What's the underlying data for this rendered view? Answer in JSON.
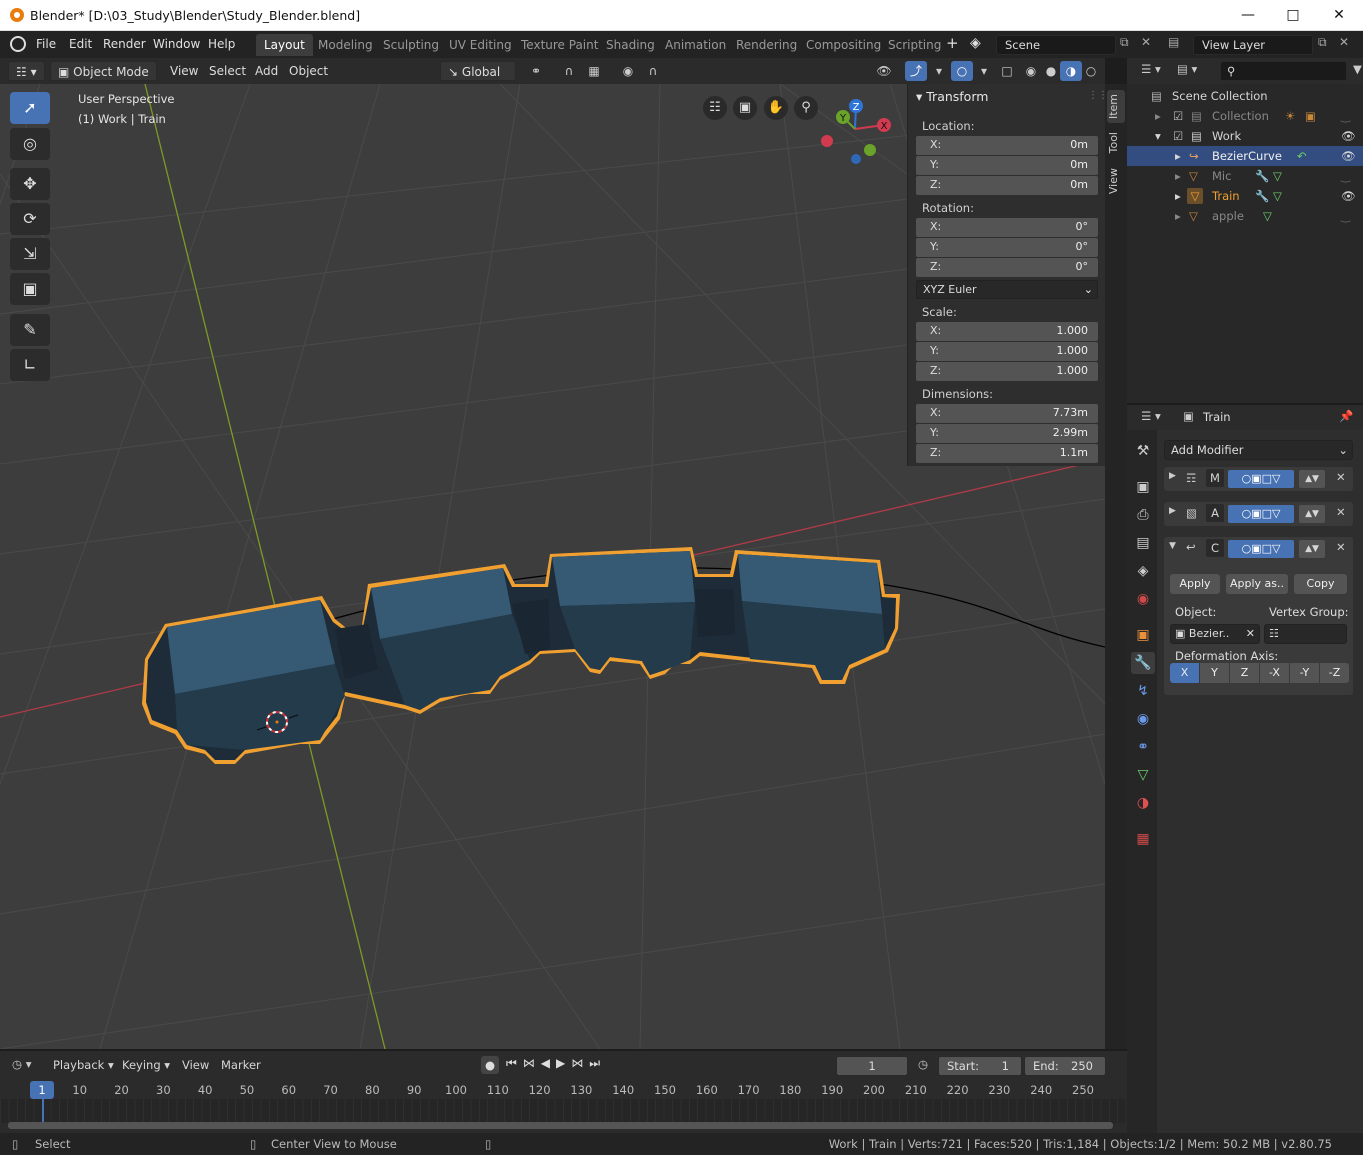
{
  "window": {
    "title": "Blender* [D:\\03_Study\\Blender\\Study_Blender.blend]"
  },
  "menu": [
    "File",
    "Edit",
    "Render",
    "Window",
    "Help"
  ],
  "workspaces": [
    "Layout",
    "Modeling",
    "Sculpting",
    "UV Editing",
    "Texture Paint",
    "Shading",
    "Animation",
    "Rendering",
    "Compositing",
    "Scripting"
  ],
  "scene": "Scene",
  "view_layer": "View Layer",
  "viewport_header": {
    "mode": "Object Mode",
    "menus": [
      "View",
      "Select",
      "Add",
      "Object"
    ],
    "orientation": "Global"
  },
  "overlay_text": {
    "perspective": "User Perspective",
    "context": "(1) Work | Train"
  },
  "gizmo": {
    "x": "X",
    "y": "Y",
    "z": "Z"
  },
  "npanel": {
    "title": "Transform",
    "tabs": [
      "Item",
      "Tool",
      "View"
    ],
    "location_label": "Location:",
    "location": [
      {
        "k": "X:",
        "v": "0m"
      },
      {
        "k": "Y:",
        "v": "0m"
      },
      {
        "k": "Z:",
        "v": "0m"
      }
    ],
    "rotation_label": "Rotation:",
    "rotation": [
      {
        "k": "X:",
        "v": "0°"
      },
      {
        "k": "Y:",
        "v": "0°"
      },
      {
        "k": "Z:",
        "v": "0°"
      }
    ],
    "rotation_mode": "XYZ Euler",
    "scale_label": "Scale:",
    "scale": [
      {
        "k": "X:",
        "v": "1.000"
      },
      {
        "k": "Y:",
        "v": "1.000"
      },
      {
        "k": "Z:",
        "v": "1.000"
      }
    ],
    "dimensions_label": "Dimensions:",
    "dimensions": [
      {
        "k": "X:",
        "v": "7.73m"
      },
      {
        "k": "Y:",
        "v": "2.99m"
      },
      {
        "k": "Z:",
        "v": "1.1m"
      }
    ]
  },
  "outliner": {
    "root": "Scene Collection",
    "items": [
      {
        "label": "Collection",
        "dim": true
      },
      {
        "label": "Work",
        "dim": false
      },
      {
        "label": "BezierCurve",
        "dim": false,
        "selected": true
      },
      {
        "label": "Mic",
        "dim": true
      },
      {
        "label": "Train",
        "dim": false,
        "active": true
      },
      {
        "label": "apple",
        "dim": true
      }
    ]
  },
  "properties": {
    "object": "Train",
    "add_modifier": "Add Modifier",
    "modifiers": [
      {
        "letter": "M"
      },
      {
        "letter": "A"
      },
      {
        "letter": "C"
      }
    ],
    "apply": "Apply",
    "apply_as": "Apply as..",
    "copy": "Copy",
    "object_label": "Object:",
    "object_value": "Bezier..",
    "vertex_group_label": "Vertex Group:",
    "deformation_axis_label": "Deformation Axis:",
    "axes": [
      "X",
      "Y",
      "Z",
      "-X",
      "-Y",
      "-Z"
    ]
  },
  "timeline": {
    "menus": [
      "Playback",
      "Keying",
      "View",
      "Marker"
    ],
    "current_frame": "1",
    "start_label": "Start:",
    "start": "1",
    "end_label": "End:",
    "end": "250",
    "ticks": [
      "1",
      "10",
      "20",
      "30",
      "40",
      "50",
      "60",
      "70",
      "80",
      "90",
      "100",
      "110",
      "120",
      "130",
      "140",
      "150",
      "160",
      "170",
      "180",
      "190",
      "200",
      "210",
      "220",
      "230",
      "240",
      "250"
    ]
  },
  "statusbar": {
    "select": "Select",
    "center": "Center View to Mouse",
    "stats": "Work | Train | Verts:721 | Faces:520 | Tris:1,184 | Objects:1/2 | Mem: 50.2 MB | v2.80.75"
  },
  "colors": {
    "accent": "#4772b3",
    "selection_outline": "#f0a030",
    "x_axis": "#c0404a",
    "y_axis": "#8cad30",
    "train_body": "#2f4a5e"
  }
}
